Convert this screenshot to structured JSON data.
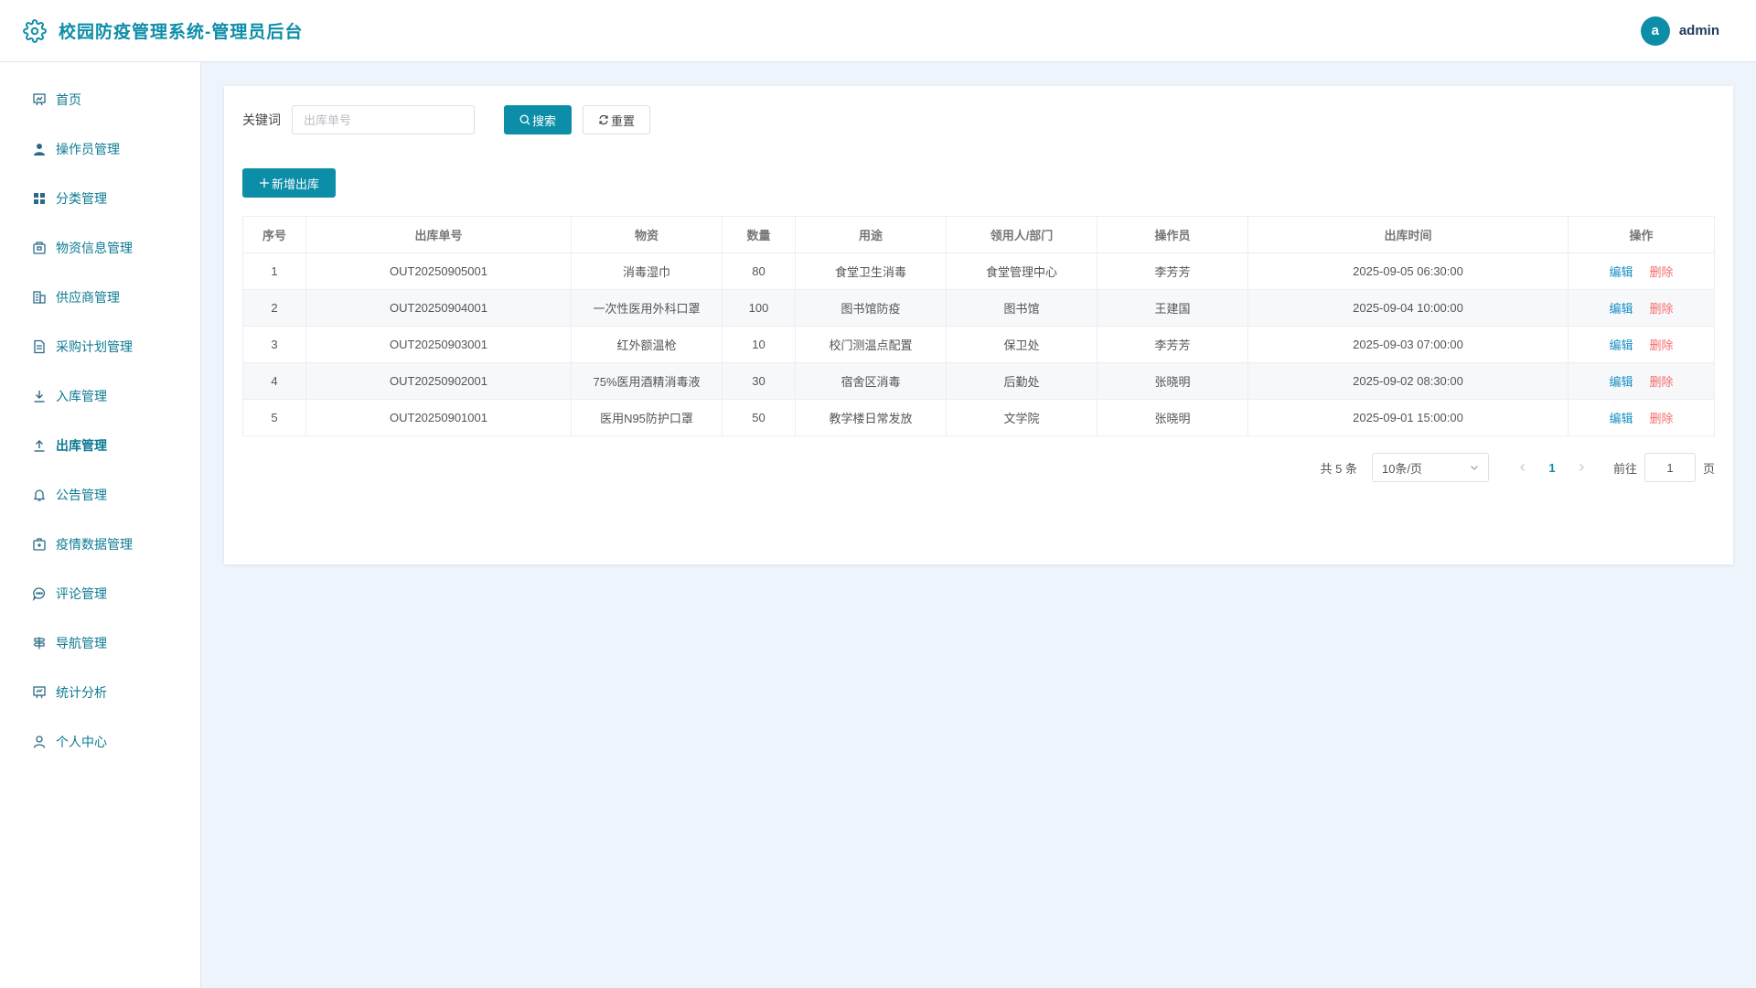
{
  "app": {
    "title": "校园防疫管理系统-管理员后台",
    "logo_icon": "gear-icon",
    "accent_color": "#0d8ea8",
    "danger_color": "#f56c6c"
  },
  "user": {
    "avatar_letter": "a",
    "name": "admin"
  },
  "sidebar": {
    "items": [
      {
        "label": "首页",
        "icon": "dashboard-icon"
      },
      {
        "label": "操作员管理",
        "icon": "user-icon"
      },
      {
        "label": "分类管理",
        "icon": "grid-icon"
      },
      {
        "label": "物资信息管理",
        "icon": "box-icon"
      },
      {
        "label": "供应商管理",
        "icon": "building-icon"
      },
      {
        "label": "采购计划管理",
        "icon": "document-icon"
      },
      {
        "label": "入库管理",
        "icon": "download-icon"
      },
      {
        "label": "出库管理",
        "icon": "upload-icon",
        "active": true
      },
      {
        "label": "公告管理",
        "icon": "bell-icon"
      },
      {
        "label": "疫情数据管理",
        "icon": "first-aid-icon"
      },
      {
        "label": "评论管理",
        "icon": "chat-icon"
      },
      {
        "label": "导航管理",
        "icon": "guide-icon"
      },
      {
        "label": "统计分析",
        "icon": "chart-icon"
      },
      {
        "label": "个人中心",
        "icon": "person-icon"
      }
    ]
  },
  "search": {
    "label": "关键词",
    "placeholder": "出库单号",
    "value": "",
    "search_label": "搜索",
    "reset_label": "重置"
  },
  "toolbar": {
    "add_label": "新增出库"
  },
  "table": {
    "columns": [
      "序号",
      "出库单号",
      "物资",
      "数量",
      "用途",
      "领用人/部门",
      "操作员",
      "出库时间",
      "操作"
    ],
    "rows": [
      [
        "1",
        "OUT20250905001",
        "消毒湿巾",
        "80",
        "食堂卫生消毒",
        "食堂管理中心",
        "李芳芳",
        "2025-09-05 06:30:00"
      ],
      [
        "2",
        "OUT20250904001",
        "一次性医用外科口罩",
        "100",
        "图书馆防疫",
        "图书馆",
        "王建国",
        "2025-09-04 10:00:00"
      ],
      [
        "3",
        "OUT20250903001",
        "红外额温枪",
        "10",
        "校门测温点配置",
        "保卫处",
        "李芳芳",
        "2025-09-03 07:00:00"
      ],
      [
        "4",
        "OUT20250902001",
        "75%医用酒精消毒液",
        "30",
        "宿舍区消毒",
        "后勤处",
        "张晓明",
        "2025-09-02 08:30:00"
      ],
      [
        "5",
        "OUT20250901001",
        "医用N95防护口罩",
        "50",
        "教学楼日常发放",
        "文学院",
        "张晓明",
        "2025-09-01 15:00:00"
      ]
    ],
    "edit_label": "编辑",
    "delete_label": "删除"
  },
  "pagination": {
    "total_text": "共 5 条",
    "page_size": "10条/页",
    "current_page": "1",
    "goto_label": "前往",
    "goto_value": "1",
    "page_suffix": "页"
  }
}
